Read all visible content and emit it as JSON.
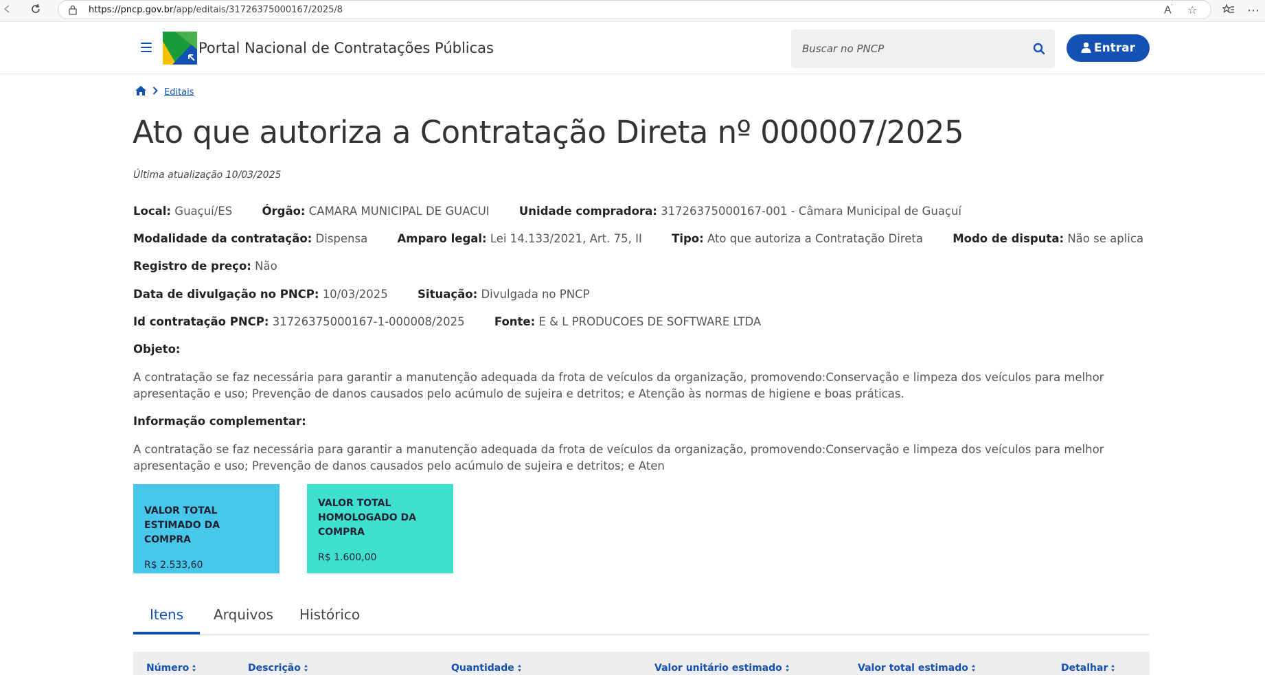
{
  "browser": {
    "url_domain": "https://pncp.gov.br",
    "url_path": "/app/editais/31726375000167/2025/8"
  },
  "header": {
    "title": "Portal Nacional de Contratações Públicas",
    "search_placeholder": "Buscar no PNCP",
    "login_label": "Entrar"
  },
  "breadcrumb": {
    "items": [
      "Editais"
    ]
  },
  "page": {
    "title": "Ato que autoriza a Contratação Direta nº 000007/2025",
    "updated": "Última atualização 10/03/2025"
  },
  "details": {
    "local_label": "Local:",
    "local": "Guaçuí/ES",
    "orgao_label": "Órgão:",
    "orgao": "CAMARA MUNICIPAL DE GUACUI",
    "unidade_label": "Unidade compradora:",
    "unidade": "31726375000167-001 - Câmara Municipal de Guaçuí",
    "modalidade_label": "Modalidade da contratação:",
    "modalidade": "Dispensa",
    "amparo_label": "Amparo legal:",
    "amparo": "Lei 14.133/2021, Art. 75, II",
    "tipo_label": "Tipo:",
    "tipo": "Ato que autoriza a Contratação Direta",
    "disputa_label": "Modo de disputa:",
    "disputa": "Não se aplica",
    "registro_label": "Registro de preço:",
    "registro": "Não",
    "divulgacao_label": "Data de divulgação no PNCP:",
    "divulgacao": "10/03/2025",
    "situacao_label": "Situação:",
    "situacao": "Divulgada no PNCP",
    "id_label": "Id contratação PNCP:",
    "id": "31726375000167-1-000008/2025",
    "fonte_label": "Fonte:",
    "fonte": "E & L PRODUCOES DE SOFTWARE LTDA"
  },
  "objeto": {
    "label": "Objeto:",
    "text": "A contratação se faz necessária para garantir a manutenção adequada da frota de veículos da organização, promovendo:Conservação e limpeza dos veículos para melhor apresentação e uso; Prevenção de danos causados pelo acúmulo de sujeira e detritos; e Atenção às normas de higiene e boas práticas."
  },
  "info": {
    "label": "Informação complementar:",
    "text": "A contratação se faz necessária para garantir a manutenção adequada da frota de veículos da organização, promovendo:Conservação e limpeza dos veículos para melhor apresentação e uso; Prevenção de danos causados pelo acúmulo de sujeira e detritos; e Aten"
  },
  "cards": [
    {
      "title": "VALOR TOTAL ESTIMADO DA COMPRA",
      "value": "R$ 2.533,60",
      "color": "#47c8eb"
    },
    {
      "title": "VALOR TOTAL HOMOLOGADO DA COMPRA",
      "value": "R$ 1.600,00",
      "color": "#3ee0d0"
    }
  ],
  "tabs": [
    "Itens",
    "Arquivos",
    "Histórico"
  ],
  "table": {
    "columns": [
      "Número",
      "Descrição",
      "Quantidade",
      "Valor unitário estimado",
      "Valor total estimado",
      "Detalhar"
    ]
  },
  "colors": {
    "primary": "#1351b4",
    "card_estimado": "#47c8eb",
    "card_homologado": "#3ee0d0"
  }
}
